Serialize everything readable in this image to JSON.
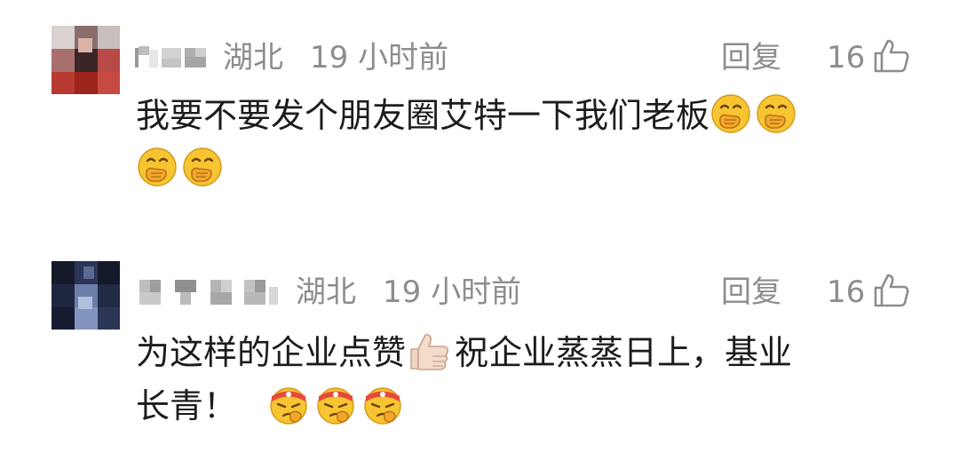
{
  "comments": [
    {
      "location": "湖北",
      "time": "19 小时前",
      "reply_label": "回复",
      "likes": "16",
      "line1": "我要不要发个朋友圈艾特一下我们老板",
      "line2": "",
      "line1_emojis": [
        "face-with-hand-over-mouth-emoji",
        "face-with-hand-over-mouth-emoji"
      ],
      "line2_emojis": [
        "face-with-hand-over-mouth-emoji",
        "face-with-hand-over-mouth-emoji"
      ]
    },
    {
      "location": "湖北",
      "time": "19 小时前",
      "reply_label": "回复",
      "likes": "16",
      "line1_a": "为这样的企业点赞",
      "line1_b": "祝企业蒸蒸日上，基业",
      "line2": "长青！",
      "line1_emojis": [
        "thumbs-up-emoji"
      ],
      "line2_emojis": [
        "determined-face-headband-emoji",
        "determined-face-headband-emoji",
        "determined-face-headband-emoji"
      ]
    }
  ],
  "colors": {
    "meta_gray": "#8d8d8d",
    "text": "#1c1c1c",
    "background": "#ffffff"
  },
  "icons": {
    "like": "thumbs-up-outline-icon"
  }
}
